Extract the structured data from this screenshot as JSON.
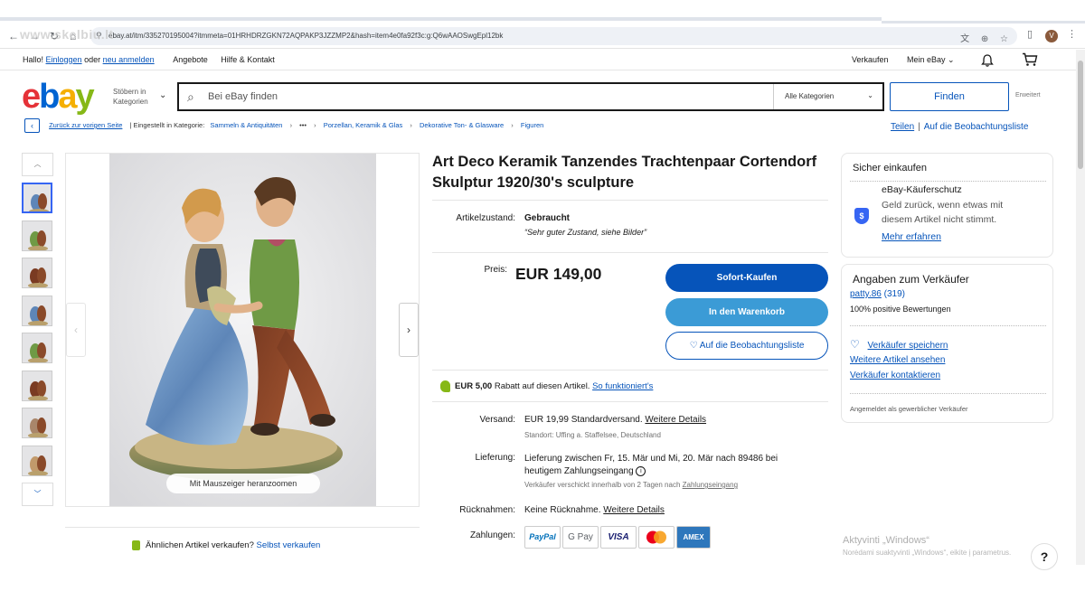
{
  "browser": {
    "url": "ebay.at/itm/335270195004?itmmeta=01HRHDRZGKN72AQPAKP3JZZMP2&hash=item4e0fa92f3c:g:Q6wAAOSwgEpl12bk",
    "avatar_letter": "V",
    "watermark": "www.skelbiu.lt"
  },
  "utility_bar": {
    "greeting": "Hallo!",
    "login": "Einloggen",
    "or": "oder",
    "register": "neu anmelden",
    "deals": "Angebote",
    "help": "Hilfe & Kontakt",
    "sell": "Verkaufen",
    "my_ebay": "Mein eBay"
  },
  "header": {
    "logo": [
      "e",
      "b",
      "a",
      "y"
    ],
    "browse_line1": "Stöbern in",
    "browse_line2": "Kategorien",
    "search_placeholder": "Bei eBay finden",
    "category_select": "Alle Kategorien",
    "find_button": "Finden",
    "advanced": "Erweitert"
  },
  "breadcrumb": {
    "back": "Zurück zur vorigen Seite",
    "listed_in": "| Eingestellt in Kategorie:",
    "items": [
      "Sammeln & Antiquitäten",
      "•••",
      "Porzellan, Keramik & Glas",
      "Dekorative Ton- & Glasware",
      "Figuren"
    ],
    "share": "Teilen",
    "watchlist": "Auf die Beobachtungsliste"
  },
  "gallery": {
    "zoom_hint": "Mit Mauszeiger heranzoomen",
    "thumb_count": 8,
    "selected_index": 0
  },
  "sell_similar": {
    "question": "Ähnlichen Artikel verkaufen?",
    "link": "Selbst verkaufen"
  },
  "item": {
    "title": "Art Deco Keramik Tanzendes Trachtenpaar Cortendorf Skulptur 1920/30's sculpture",
    "condition_label": "Artikelzustand:",
    "condition_value": "Gebraucht",
    "condition_note": "“Sehr guter Zustand, siehe Bilder”",
    "price_label": "Preis:",
    "price": "EUR 149,00",
    "buy_now": "Sofort-Kaufen",
    "add_to_cart": "In den Warenkorb",
    "add_to_watchlist": "♡ Auf die Beobachtungsliste",
    "discount_amount": "EUR 5,00",
    "discount_text": "Rabatt auf diesen Artikel.",
    "discount_link": "So funktioniert's",
    "shipping_label": "Versand:",
    "shipping_value": "EUR 19,99 Standardversand.",
    "shipping_link": "Weitere Details",
    "shipping_location": "Standort: Uffing a. Staffelsee, Deutschland",
    "delivery_label": "Lieferung:",
    "delivery_line1": "Lieferung zwischen Fr, 15. Mär und Mi, 20. Mär nach 89486 bei",
    "delivery_line2": "heutigem Zahlungseingang",
    "delivery_note_prefix": "Verkäufer verschickt innerhalb von 2 Tagen nach",
    "delivery_note_link": "Zahlungseingang",
    "returns_label": "Rücknahmen:",
    "returns_value": "Keine Rücknahme.",
    "returns_link": "Weitere Details",
    "payments_label": "Zahlungen:",
    "payments": [
      "PayPal",
      "G Pay",
      "VISA",
      "Mastercard",
      "AMEX"
    ]
  },
  "safe_buying": {
    "title": "Sicher einkaufen",
    "protection_title": "eBay-Käuferschutz",
    "protection_text1": "Geld zurück, wenn etwas mit",
    "protection_text2": "diesem Artikel nicht stimmt.",
    "learn_more": "Mehr erfahren"
  },
  "seller": {
    "title": "Angaben zum Verkäufer",
    "name": "patty.86",
    "rating": "(319)",
    "positive": "100% positive Bewertungen",
    "save": "Verkäufer speichern",
    "other_items": "Weitere Artikel ansehen",
    "contact": "Verkäufer kontaktieren",
    "business_note": "Angemeldet als gewerblicher Verkäufer"
  },
  "windows_watermark": {
    "line1": "Aktyvinti „Windows“",
    "line2": "Norėdami suaktyvinti „Windows“, eikite į parametrus."
  },
  "help_button": "?",
  "colors": {
    "link": "#0654ba",
    "buy_button": "#0654ba",
    "cart_button": "#3b9bd6",
    "logo_e": "#e53238",
    "logo_b": "#0064d2",
    "logo_a": "#f5af02",
    "logo_y": "#86b817"
  }
}
